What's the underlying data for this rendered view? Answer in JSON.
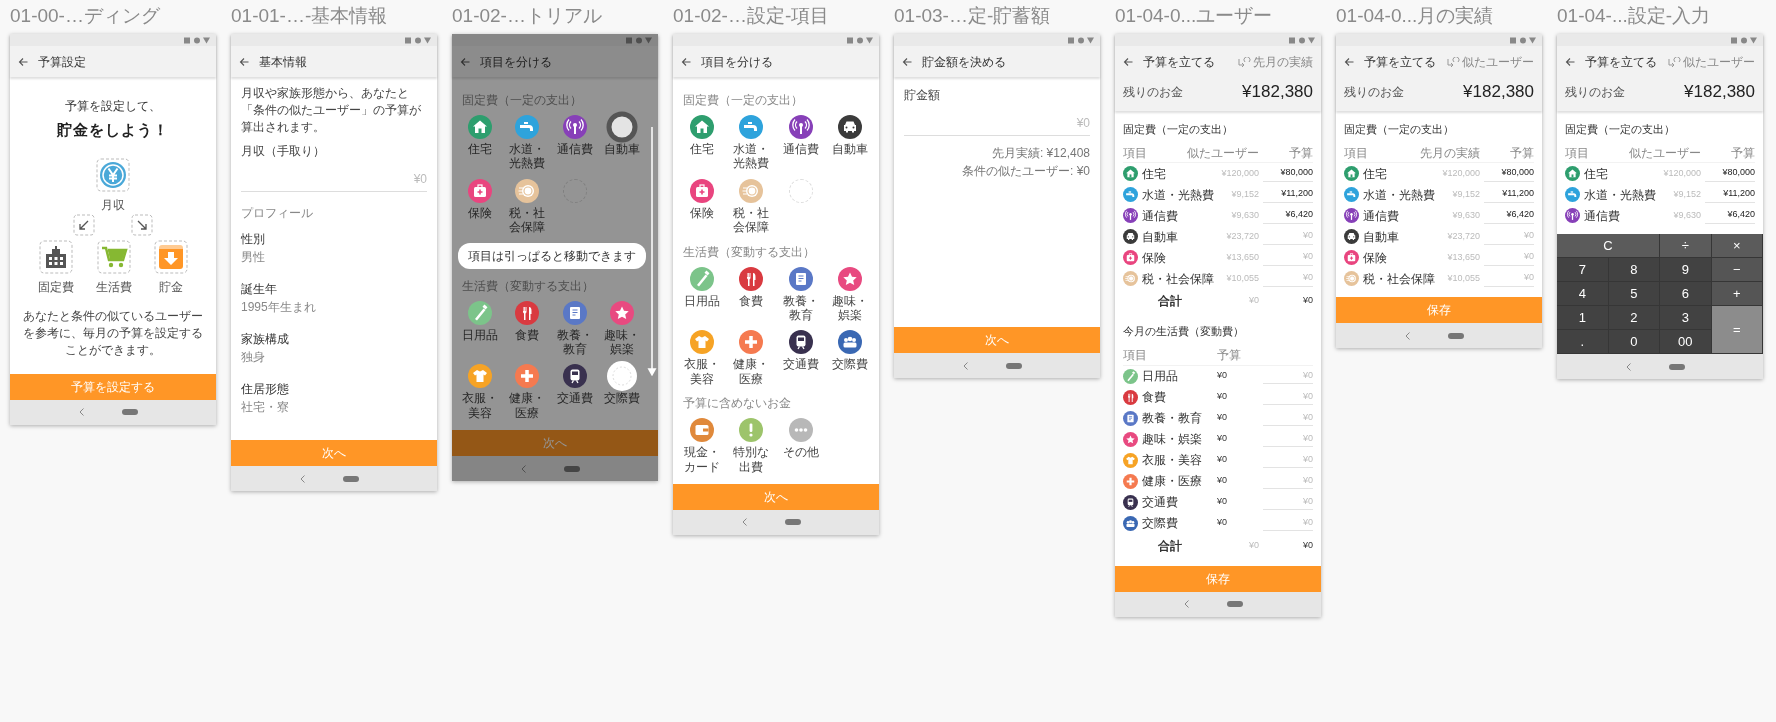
{
  "screens": [
    {
      "kind": "onboarding",
      "caption": "01-00-…ディング",
      "title": "予算設定",
      "lead": "予算を設定して、",
      "headline": "貯金をしよう！",
      "diagram": {
        "source": "月収",
        "targets": [
          "固定費",
          "生活費",
          "貯金"
        ]
      },
      "note": "あなたと条件の似ているユーザーを参考に、毎月の予算を設定することができます。",
      "button": "予算を設定する"
    },
    {
      "kind": "profile",
      "caption": "01-01-…-基本情報",
      "title": "基本情報",
      "intro": "月収や家族形態から、あなたと「条件の似たユーザー」の予算が算出されます。",
      "field": {
        "label": "月収（手取り）",
        "placeholder": "¥0"
      },
      "section": "プロフィール",
      "items": [
        {
          "label": "性別",
          "value": "男性"
        },
        {
          "label": "誕生年",
          "value": "1995年生まれ"
        },
        {
          "label": "家族構成",
          "value": "独身"
        },
        {
          "label": "住居形態",
          "value": "社宅・寮"
        }
      ],
      "button": "次へ"
    },
    {
      "kind": "tutorial",
      "caption": "01-02-…トリアル",
      "title": "項目を分ける",
      "groups": [
        {
          "heading": "固定費（一定の支出）",
          "items": [
            {
              "kind": "category",
              "label": "住宅",
              "color": "#2e9e6e"
            },
            {
              "kind": "category",
              "label": "水道・光熱費",
              "color": "#2ea3dc"
            },
            {
              "kind": "category",
              "label": "通信費",
              "color": "#8740b8"
            },
            {
              "kind": "dragging",
              "label": "自動車"
            },
            {
              "kind": "category",
              "label": "保険",
              "color": "#e9457f"
            },
            {
              "kind": "category",
              "label": "税・社会保障",
              "color": "#e6c39b"
            },
            {
              "kind": "empty"
            }
          ]
        },
        {
          "heading": "生活費（変動する支出）",
          "items": [
            {
              "kind": "category",
              "label": "日用品",
              "color": "#7cc48a"
            },
            {
              "kind": "category",
              "label": "食費",
              "color": "#d93a40"
            },
            {
              "kind": "category",
              "label": "教養・教育",
              "color": "#5a78c6"
            },
            {
              "kind": "category",
              "label": "趣味・娯楽",
              "color": "#e84a80"
            },
            {
              "kind": "category",
              "label": "衣服・美容",
              "color": "#f6a325"
            },
            {
              "kind": "category",
              "label": "健康・医療",
              "color": "#f57a50"
            },
            {
              "kind": "category",
              "label": "交通費",
              "color": "#39314f"
            },
            {
              "kind": "drop",
              "label": "交際費"
            }
          ]
        }
      ],
      "tooltip": "項目は引っぱると移動できます",
      "button": "次へ"
    },
    {
      "kind": "categories",
      "caption": "01-02-…設定-項目",
      "title": "項目を分ける",
      "groups": [
        {
          "heading": "固定費（一定の支出）",
          "items": [
            {
              "kind": "category",
              "label": "住宅",
              "color": "#2e9e6e"
            },
            {
              "kind": "category",
              "label": "水道・光熱費",
              "color": "#2ea3dc"
            },
            {
              "kind": "category",
              "label": "通信費",
              "color": "#8740b8"
            },
            {
              "kind": "category",
              "label": "自動車",
              "color": "#3b3b3b"
            },
            {
              "kind": "category",
              "label": "保険",
              "color": "#e9457f"
            },
            {
              "kind": "category",
              "label": "税・社会保障",
              "color": "#e6c39b"
            },
            {
              "kind": "empty"
            }
          ]
        },
        {
          "heading": "生活費（変動する支出）",
          "items": [
            {
              "kind": "category",
              "label": "日用品",
              "color": "#7cc48a"
            },
            {
              "kind": "category",
              "label": "食費",
              "color": "#d93a40"
            },
            {
              "kind": "category",
              "label": "教養・教育",
              "color": "#5a78c6"
            },
            {
              "kind": "category",
              "label": "趣味・娯楽",
              "color": "#e84a80"
            },
            {
              "kind": "category",
              "label": "衣服・美容",
              "color": "#f6a325"
            },
            {
              "kind": "category",
              "label": "健康・医療",
              "color": "#f57a50"
            },
            {
              "kind": "category",
              "label": "交通費",
              "color": "#39314f"
            },
            {
              "kind": "category",
              "label": "交際費",
              "color": "#3a68b3"
            }
          ]
        },
        {
          "heading": "予算に含めないお金",
          "items": [
            {
              "kind": "category",
              "label": "現金・カード",
              "color": "#e0893b"
            },
            {
              "kind": "category",
              "label": "特別な出費",
              "color": "#9dc46b"
            },
            {
              "kind": "category",
              "label": "その他",
              "color": "#b8b8b8"
            }
          ]
        }
      ],
      "button": "次へ"
    },
    {
      "kind": "savings",
      "caption": "01-03-…定-貯蓄額",
      "title": "貯金額を決める",
      "field": {
        "label": "貯金額",
        "placeholder": "¥0"
      },
      "hints": [
        "先月実績: ¥12,408",
        "条件の似たユーザー: ¥0"
      ],
      "button": "次へ"
    },
    {
      "kind": "budget",
      "caption": "01-04-0...ユーザー",
      "title": "予算を立てる",
      "toggle": "先月の実績",
      "remaining_label": "残りのお金",
      "remaining": "¥182,380",
      "sections": [
        {
          "kind": "fixed",
          "heading": "固定費（一定の支出）",
          "columns": [
            "項目",
            "似たユーザー",
            "予算"
          ],
          "rows": [
            {
              "name": "住宅",
              "color": "#2e9e6e",
              "reference": "¥120,000",
              "input": {
                "value": "¥80,000"
              }
            },
            {
              "name": "水道・光熱費",
              "color": "#2ea3dc",
              "reference": "¥9,152",
              "input": {
                "value": "¥11,200"
              }
            },
            {
              "name": "通信費",
              "color": "#8740b8",
              "reference": "¥9,630",
              "input": {
                "value": "¥6,420"
              }
            },
            {
              "name": "自動車",
              "color": "#3b3b3b",
              "reference": "¥23,720",
              "input": {
                "placeholder": "¥0"
              }
            },
            {
              "name": "保険",
              "color": "#e9457f",
              "reference": "¥13,650",
              "input": {
                "placeholder": "¥0"
              }
            },
            {
              "name": "税・社会保障",
              "color": "#e6c39b",
              "reference": "¥10,055",
              "input": {
                "placeholder": "¥0"
              }
            }
          ],
          "total": {
            "label": "合計",
            "reference": "¥0",
            "budget": "¥0"
          }
        },
        {
          "kind": "variable",
          "heading": "今月の生活費（変動費）",
          "columns": [
            "項目",
            "予算"
          ],
          "rows": [
            {
              "name": "日用品",
              "color": "#7cc48a",
              "reference": "¥0",
              "input": {
                "placeholder": "¥0"
              }
            },
            {
              "name": "食費",
              "color": "#d93a40",
              "reference": "¥0",
              "input": {
                "placeholder": "¥0"
              }
            },
            {
              "name": "教養・教育",
              "color": "#5a78c6",
              "reference": "¥0",
              "input": {
                "placeholder": "¥0"
              }
            },
            {
              "name": "趣味・娯楽",
              "color": "#e84a80",
              "reference": "¥0",
              "input": {
                "placeholder": "¥0"
              }
            },
            {
              "name": "衣服・美容",
              "color": "#f6a325",
              "reference": "¥0",
              "input": {
                "placeholder": "¥0"
              }
            },
            {
              "name": "健康・医療",
              "color": "#f57a50",
              "reference": "¥0",
              "input": {
                "placeholder": "¥0"
              }
            },
            {
              "name": "交通費",
              "color": "#39314f",
              "reference": "¥0",
              "input": {
                "placeholder": "¥0"
              }
            },
            {
              "name": "交際費",
              "color": "#3a68b3",
              "reference": "¥0",
              "input": {
                "placeholder": "¥0"
              }
            }
          ],
          "total": {
            "label": "合計",
            "reference": "¥0",
            "budget": "¥0"
          }
        }
      ],
      "button": "保存"
    },
    {
      "kind": "budget",
      "caption": "01-04-0...月の実績",
      "title": "予算を立てる",
      "toggle": "似たユーザー",
      "remaining_label": "残りのお金",
      "remaining": "¥182,380",
      "sections": [
        {
          "kind": "fixed",
          "heading": "固定費（一定の支出）",
          "columns": [
            "項目",
            "先月の実績",
            "予算"
          ],
          "rows": [
            {
              "name": "住宅",
              "color": "#2e9e6e",
              "reference": "¥120,000",
              "input": {
                "value": "¥80,000"
              }
            },
            {
              "name": "水道・光熱費",
              "color": "#2ea3dc",
              "reference": "¥9,152",
              "input": {
                "value": "¥11,200"
              }
            },
            {
              "name": "通信費",
              "color": "#8740b8",
              "reference": "¥9,630",
              "input": {
                "value": "¥6,420"
              }
            },
            {
              "name": "自動車",
              "color": "#3b3b3b",
              "reference": "¥23,720",
              "input": {
                "placeholder": "¥0"
              }
            },
            {
              "name": "保険",
              "color": "#e9457f",
              "reference": "¥13,650",
              "input": {
                "placeholder": "¥0"
              }
            },
            {
              "name": "税・社会保障",
              "color": "#e6c39b",
              "reference": "¥10,055",
              "input": {
                "placeholder": "¥0"
              }
            }
          ]
        }
      ],
      "button": "保存"
    },
    {
      "kind": "budget",
      "caption": "01-04-...設定-入力",
      "title": "予算を立てる",
      "toggle": "似たユーザー",
      "remaining_label": "残りのお金",
      "remaining": "¥182,380",
      "sections": [
        {
          "kind": "fixed",
          "heading": "固定費（一定の支出）",
          "columns": [
            "項目",
            "似たユーザー",
            "予算"
          ],
          "rows": [
            {
              "name": "住宅",
              "color": "#2e9e6e",
              "reference": "¥120,000",
              "input": {
                "value": "¥80,000"
              }
            },
            {
              "name": "水道・光熱費",
              "color": "#2ea3dc",
              "reference": "¥9,152",
              "input": {
                "value": "¥11,200"
              }
            },
            {
              "name": "通信費",
              "color": "#8740b8",
              "reference": "¥9,630",
              "input": {
                "value": "¥6,420"
              }
            }
          ]
        }
      ],
      "keypad": [
        {
          "label": "C",
          "kind": "clear"
        },
        {
          "label": "÷",
          "kind": "function"
        },
        {
          "label": "×",
          "kind": "function"
        },
        {
          "label": "7",
          "kind": "digit"
        },
        {
          "label": "8",
          "kind": "digit"
        },
        {
          "label": "9",
          "kind": "digit"
        },
        {
          "label": "−",
          "kind": "operator"
        },
        {
          "label": "4",
          "kind": "digit"
        },
        {
          "label": "5",
          "kind": "digit"
        },
        {
          "label": "6",
          "kind": "digit"
        },
        {
          "label": "+",
          "kind": "operator"
        },
        {
          "label": "1",
          "kind": "digit"
        },
        {
          "label": "2",
          "kind": "digit"
        },
        {
          "label": "3",
          "kind": "digit"
        },
        {
          "label": "=",
          "kind": "equals"
        },
        {
          "label": ".",
          "kind": "digit"
        },
        {
          "label": "0",
          "kind": "digit"
        },
        {
          "label": "00",
          "kind": "digit"
        }
      ]
    }
  ]
}
